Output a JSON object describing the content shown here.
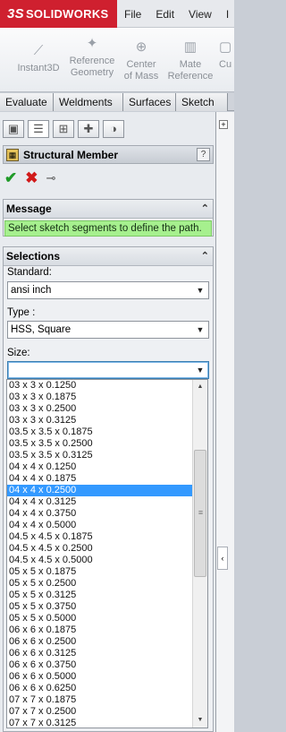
{
  "app": {
    "brand_prefix": "3S",
    "brand": "SOLIDWORKS"
  },
  "menu": [
    "File",
    "Edit",
    "View",
    "I"
  ],
  "ribbon": {
    "instant3d": "Instant3D",
    "reference_geometry": [
      "Reference",
      "Geometry"
    ],
    "center_of_mass": [
      "Center",
      "of Mass"
    ],
    "mate_reference": [
      "Mate",
      "Reference"
    ],
    "cut": "Cu"
  },
  "tabs": [
    "Evaluate",
    "Weldments",
    "Surfaces",
    "Sketch"
  ],
  "property_manager": {
    "title": "Structural Member",
    "help": "?",
    "message_header": "Message",
    "message": "Select sketch segments to define the path.",
    "selections_header": "Selections",
    "standard_label": "Standard:",
    "standard_value": "ansi inch",
    "type_label": "Type :",
    "type_value": "HSS, Square",
    "size_label": "Size:",
    "size_value": ""
  },
  "size_options": [
    "03 x 3 x 0.1250",
    "03 x 3 x 0.1875",
    "03 x 3 x 0.2500",
    "03 x 3 x 0.3125",
    "03.5 x 3.5 x 0.1875",
    "03.5 x 3.5 x 0.2500",
    "03.5 x 3.5 x 0.3125",
    "04 x 4 x 0.1250",
    "04 x 4 x 0.1875",
    "04 x 4 x 0.2500",
    "04 x 4 x 0.3125",
    "04 x 4 x 0.3750",
    "04 x 4 x 0.5000",
    "04.5 x 4.5 x 0.1875",
    "04.5 x 4.5 x 0.2500",
    "04.5 x 4.5 x 0.5000",
    "05 x 5 x 0.1875",
    "05 x 5 x 0.2500",
    "05 x 5 x 0.3125",
    "05 x 5 x 0.3750",
    "05 x 5 x 0.5000",
    "06 x 6 x 0.1875",
    "06 x 6 x 0.2500",
    "06 x 6 x 0.3125",
    "06 x 6 x 0.3750",
    "06 x 6 x 0.5000",
    "06 x 6 x 0.6250",
    "07 x 7 x 0.1875",
    "07 x 7 x 0.2500",
    "07 x 7 x 0.3125"
  ],
  "selected_size": "04 x 4 x 0.2500",
  "colors": {
    "brand_red": "#cf202f",
    "message_bg": "#a6f08e",
    "selection_blue": "#3399ff"
  }
}
